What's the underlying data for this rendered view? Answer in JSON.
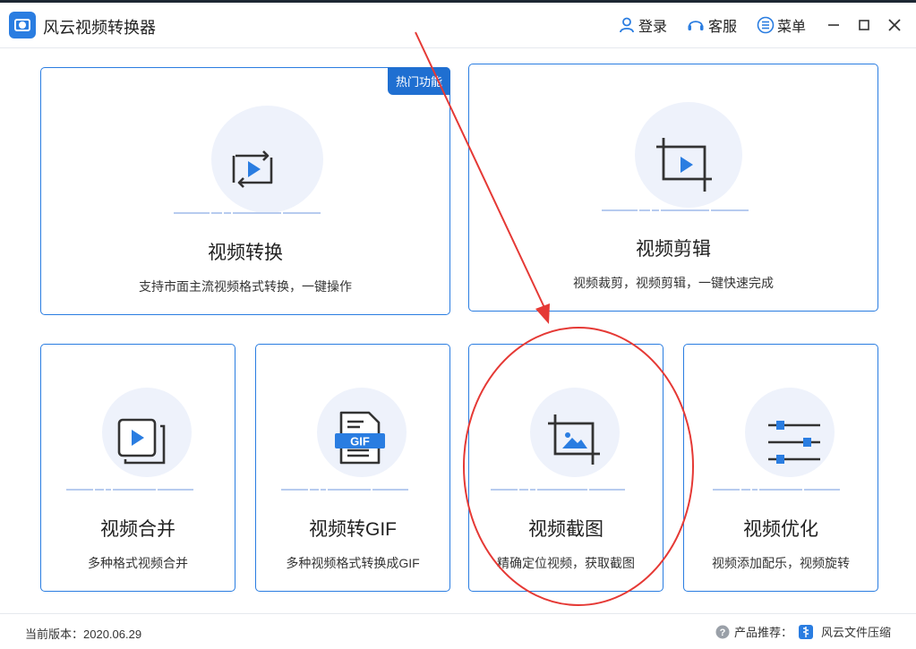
{
  "app": {
    "title": "风云视频转换器"
  },
  "header": {
    "login_label": "登录",
    "service_label": "客服",
    "menu_label": "菜单"
  },
  "cards": {
    "convert": {
      "title": "视频转换",
      "desc": "支持市面主流视频格式转换，一键操作",
      "badge": "热门功能"
    },
    "edit": {
      "title": "视频剪辑",
      "desc": "视频裁剪，视频剪辑，一键快速完成"
    },
    "merge": {
      "title": "视频合并",
      "desc": "多种格式视频合并"
    },
    "gif": {
      "title": "视频转GIF",
      "desc": "多种视频格式转换成GIF",
      "icon_text": "GIF"
    },
    "screenshot": {
      "title": "视频截图",
      "desc": "精确定位视频，获取截图"
    },
    "optimize": {
      "title": "视频优化",
      "desc": "视频添加配乐，视频旋转"
    }
  },
  "status": {
    "version_label": "当前版本：2020.06.29",
    "recommend_label": "产品推荐：",
    "recommend_product": "风云文件压缩"
  },
  "colors": {
    "accent": "#2a7de1",
    "icon_dark": "#333333",
    "annotation": "#e53935"
  }
}
